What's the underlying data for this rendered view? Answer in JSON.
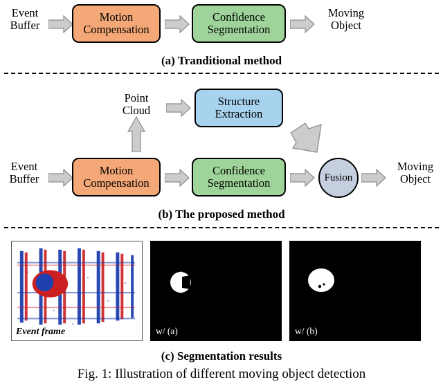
{
  "figure": {
    "caption_line1": "Fig.  1:  Illustration  of  different  moving  object  detection"
  },
  "panel_a": {
    "caption_label": "(a)",
    "caption_text": "Tranditional method",
    "nodes": {
      "event_buffer": "Event\nBuffer",
      "motion_compensation": "Motion\nCompensation",
      "confidence_segmentation": "Confidence\nSegmentation",
      "moving_object": "Moving\nObject"
    }
  },
  "panel_b": {
    "caption_label": "(b)",
    "caption_text": "The proposed method",
    "nodes": {
      "event_buffer": "Event\nBuffer",
      "motion_compensation": "Motion\nCompensation",
      "confidence_segmentation": "Confidence\nSegmentation",
      "point_cloud": "Point\nCloud",
      "structure_extraction": "Structure\nExtraction",
      "fusion": "Fusion",
      "moving_object": "Moving\nObject"
    }
  },
  "panel_c": {
    "caption_label": "(c)",
    "caption_text": "Segmentation results",
    "images": {
      "event_frame_label": "Event frame",
      "result_a_label": "w/ (a)",
      "result_b_label": "w/ (b)"
    }
  },
  "colors": {
    "orange": "#f5a877",
    "green": "#9ed49a",
    "blue": "#a8d3ee",
    "fusion_gray": "#c5cfe0",
    "arrow_gray": "#cccccc",
    "arrow_stroke": "#808080",
    "panel_bg": "#000000"
  }
}
